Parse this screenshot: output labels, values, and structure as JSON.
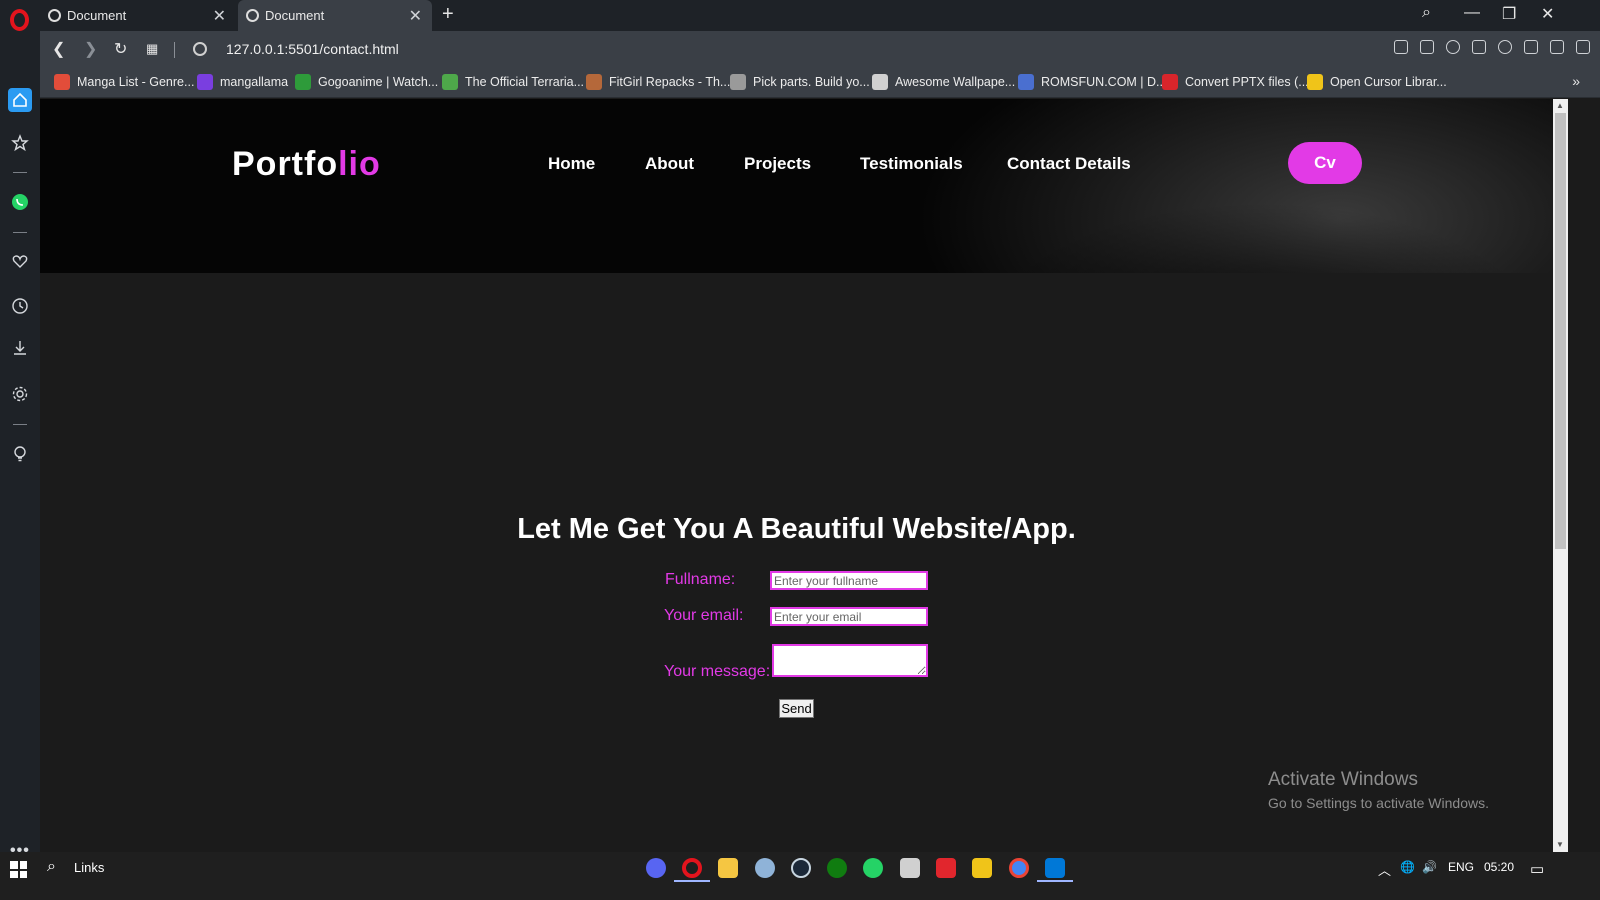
{
  "browser": {
    "tabs": [
      {
        "label": "Document"
      },
      {
        "label": "Document"
      }
    ],
    "url": "127.0.0.1:5501/contact.html",
    "bookmarks": [
      {
        "label": "Manga List - Genre...",
        "color": "#e24d3a"
      },
      {
        "label": "mangallama",
        "color": "#7a3ee0"
      },
      {
        "label": "Gogoanime | Watch...",
        "color": "#2e9b3a"
      },
      {
        "label": "The Official Terraria...",
        "color": "#4ea84a"
      },
      {
        "label": "FitGirl Repacks - Th...",
        "color": "#b5683a"
      },
      {
        "label": "Pick parts. Build yo...",
        "color": "#9a9a9a"
      },
      {
        "label": "Awesome Wallpape...",
        "color": "#d0d0d0"
      },
      {
        "label": "ROMSFUN.COM | D...",
        "color": "#4a6fd0"
      },
      {
        "label": "Convert PPTX files (...",
        "color": "#d8252b"
      },
      {
        "label": "Open Cursor Librar...",
        "color": "#f0c419"
      }
    ]
  },
  "site": {
    "logo_main": "Portfo",
    "logo_accent": "lio",
    "nav": [
      "Home",
      "About",
      "Projects",
      "Testimonials",
      "Contact Details"
    ],
    "cv_label": "Cv",
    "accent_color": "#e23ae6"
  },
  "contact": {
    "title": "Let Me Get You A Beautiful Website/App.",
    "fullname_label": "Fullname:",
    "fullname_placeholder": "Enter your fullname",
    "email_label": "Your email:",
    "email_placeholder": "Enter your email",
    "message_label": "Your message:",
    "send_label": "Send"
  },
  "watermark": {
    "line1": "Activate Windows",
    "line2": "Go to Settings to activate Windows."
  },
  "taskbar": {
    "links_label": "Links",
    "lang": "ENG",
    "time": "05:20"
  }
}
